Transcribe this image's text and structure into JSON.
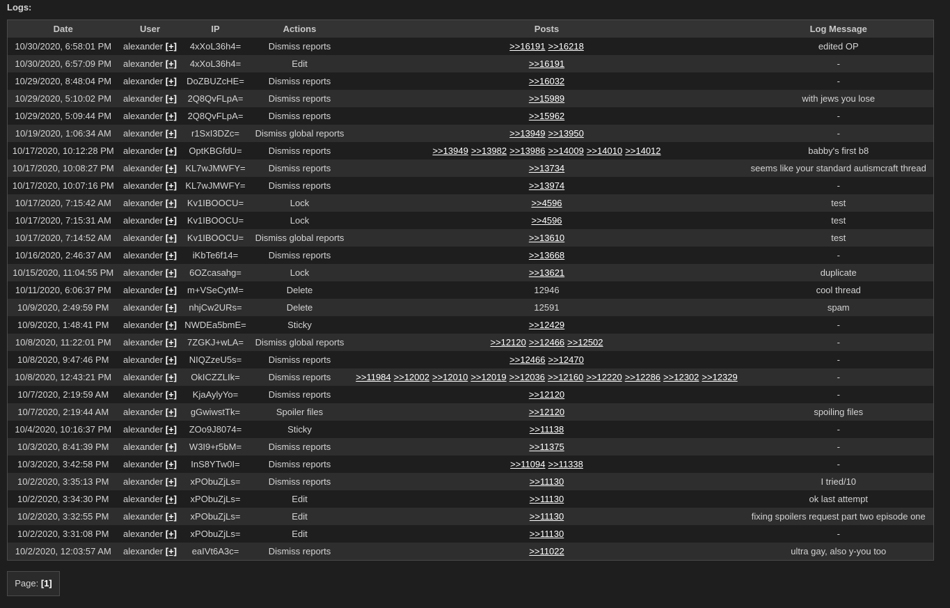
{
  "title": "Logs:",
  "columns": {
    "date": "Date",
    "user": "User",
    "ip": "IP",
    "actions": "Actions",
    "posts": "Posts",
    "message": "Log Message"
  },
  "rows": [
    {
      "date": "10/30/2020, 6:58:01 PM",
      "user": "alexander",
      "ip": "4xXoL36h4=",
      "action": "Dismiss reports",
      "posts": [
        ">>16191",
        ">>16218"
      ],
      "message": "edited OP"
    },
    {
      "date": "10/30/2020, 6:57:09 PM",
      "user": "alexander",
      "ip": "4xXoL36h4=",
      "action": "Edit",
      "posts": [
        ">>16191"
      ],
      "message": "-"
    },
    {
      "date": "10/29/2020, 8:48:04 PM",
      "user": "alexander",
      "ip": "DoZBUZcHE=",
      "action": "Dismiss reports",
      "posts": [
        ">>16032"
      ],
      "message": "-"
    },
    {
      "date": "10/29/2020, 5:10:02 PM",
      "user": "alexander",
      "ip": "2Q8QvFLpA=",
      "action": "Dismiss reports",
      "posts": [
        ">>15989"
      ],
      "message": "with jews you lose"
    },
    {
      "date": "10/29/2020, 5:09:44 PM",
      "user": "alexander",
      "ip": "2Q8QvFLpA=",
      "action": "Dismiss reports",
      "posts": [
        ">>15962"
      ],
      "message": "-"
    },
    {
      "date": "10/19/2020, 1:06:34 AM",
      "user": "alexander",
      "ip": "r1SxI3DZc=",
      "action": "Dismiss global reports",
      "posts": [
        ">>13949",
        ">>13950"
      ],
      "message": "-"
    },
    {
      "date": "10/17/2020, 10:12:28 PM",
      "user": "alexander",
      "ip": "OptKBGfdU=",
      "action": "Dismiss reports",
      "posts": [
        ">>13949",
        ">>13982",
        ">>13986",
        ">>14009",
        ">>14010",
        ">>14012"
      ],
      "message": "babby's first b8"
    },
    {
      "date": "10/17/2020, 10:08:27 PM",
      "user": "alexander",
      "ip": "KL7wJMWFY=",
      "action": "Dismiss reports",
      "posts": [
        ">>13734"
      ],
      "message": "seems like your standard autismcraft thread"
    },
    {
      "date": "10/17/2020, 10:07:16 PM",
      "user": "alexander",
      "ip": "KL7wJMWFY=",
      "action": "Dismiss reports",
      "posts": [
        ">>13974"
      ],
      "message": "-"
    },
    {
      "date": "10/17/2020, 7:15:42 AM",
      "user": "alexander",
      "ip": "Kv1IBOOCU=",
      "action": "Lock",
      "posts": [
        ">>4596"
      ],
      "message": "test"
    },
    {
      "date": "10/17/2020, 7:15:31 AM",
      "user": "alexander",
      "ip": "Kv1IBOOCU=",
      "action": "Lock",
      "posts": [
        ">>4596"
      ],
      "message": "test"
    },
    {
      "date": "10/17/2020, 7:14:52 AM",
      "user": "alexander",
      "ip": "Kv1IBOOCU=",
      "action": "Dismiss global reports",
      "posts": [
        ">>13610"
      ],
      "message": "test"
    },
    {
      "date": "10/16/2020, 2:46:37 AM",
      "user": "alexander",
      "ip": "iKbTe6f14=",
      "action": "Dismiss reports",
      "posts": [
        ">>13668"
      ],
      "message": "-"
    },
    {
      "date": "10/15/2020, 11:04:55 PM",
      "user": "alexander",
      "ip": "6OZcasahg=",
      "action": "Lock",
      "posts": [
        ">>13621"
      ],
      "message": "duplicate"
    },
    {
      "date": "10/11/2020, 6:06:37 PM",
      "user": "alexander",
      "ip": "m+VSeCytM=",
      "action": "Delete",
      "posts": [],
      "posts_text": "12946",
      "message": "cool thread"
    },
    {
      "date": "10/9/2020, 2:49:59 PM",
      "user": "alexander",
      "ip": "nhjCw2URs=",
      "action": "Delete",
      "posts": [],
      "posts_text": "12591",
      "message": "spam"
    },
    {
      "date": "10/9/2020, 1:48:41 PM",
      "user": "alexander",
      "ip": "NWDEa5bmE=",
      "action": "Sticky",
      "posts": [
        ">>12429"
      ],
      "message": "-"
    },
    {
      "date": "10/8/2020, 11:22:01 PM",
      "user": "alexander",
      "ip": "7ZGKJ+wLA=",
      "action": "Dismiss global reports",
      "posts": [
        ">>12120",
        ">>12466",
        ">>12502"
      ],
      "message": "-"
    },
    {
      "date": "10/8/2020, 9:47:46 PM",
      "user": "alexander",
      "ip": "NIQZzeU5s=",
      "action": "Dismiss reports",
      "posts": [
        ">>12466",
        ">>12470"
      ],
      "message": "-"
    },
    {
      "date": "10/8/2020, 12:43:21 PM",
      "user": "alexander",
      "ip": "OkICZZLIk=",
      "action": "Dismiss reports",
      "posts": [
        ">>11984",
        ">>12002",
        ">>12010",
        ">>12019",
        ">>12036",
        ">>12160",
        ">>12220",
        ">>12286",
        ">>12302",
        ">>12329"
      ],
      "message": "-"
    },
    {
      "date": "10/7/2020, 2:19:59 AM",
      "user": "alexander",
      "ip": "KjaAylyYo=",
      "action": "Dismiss reports",
      "posts": [
        ">>12120"
      ],
      "message": "-"
    },
    {
      "date": "10/7/2020, 2:19:44 AM",
      "user": "alexander",
      "ip": "gGwiwstTk=",
      "action": "Spoiler files",
      "posts": [
        ">>12120"
      ],
      "message": "spoiling files"
    },
    {
      "date": "10/4/2020, 10:16:37 PM",
      "user": "alexander",
      "ip": "ZOo9J8074=",
      "action": "Sticky",
      "posts": [
        ">>11138"
      ],
      "message": "-"
    },
    {
      "date": "10/3/2020, 8:41:39 PM",
      "user": "alexander",
      "ip": "W3I9+r5bM=",
      "action": "Dismiss reports",
      "posts": [
        ">>11375"
      ],
      "message": "-"
    },
    {
      "date": "10/3/2020, 3:42:58 PM",
      "user": "alexander",
      "ip": "InS8YTw0I=",
      "action": "Dismiss reports",
      "posts": [
        ">>11094",
        ">>11338"
      ],
      "message": "-"
    },
    {
      "date": "10/2/2020, 3:35:13 PM",
      "user": "alexander",
      "ip": "xPObuZjLs=",
      "action": "Dismiss reports",
      "posts": [
        ">>11130"
      ],
      "message": "I tried/10"
    },
    {
      "date": "10/2/2020, 3:34:30 PM",
      "user": "alexander",
      "ip": "xPObuZjLs=",
      "action": "Edit",
      "posts": [
        ">>11130"
      ],
      "message": "ok last attempt"
    },
    {
      "date": "10/2/2020, 3:32:55 PM",
      "user": "alexander",
      "ip": "xPObuZjLs=",
      "action": "Edit",
      "posts": [
        ">>11130"
      ],
      "message": "fixing spoilers request part two episode one"
    },
    {
      "date": "10/2/2020, 3:31:08 PM",
      "user": "alexander",
      "ip": "xPObuZjLs=",
      "action": "Edit",
      "posts": [
        ">>11130"
      ],
      "message": "-"
    },
    {
      "date": "10/2/2020, 12:03:57 AM",
      "user": "alexander",
      "ip": "eaIVt6A3c=",
      "action": "Dismiss reports",
      "posts": [
        ">>11022"
      ],
      "message": "ultra gay, also y-you too"
    }
  ],
  "user_ban_link": "[+]",
  "pager": {
    "label": "Page:",
    "current": "[1]"
  }
}
